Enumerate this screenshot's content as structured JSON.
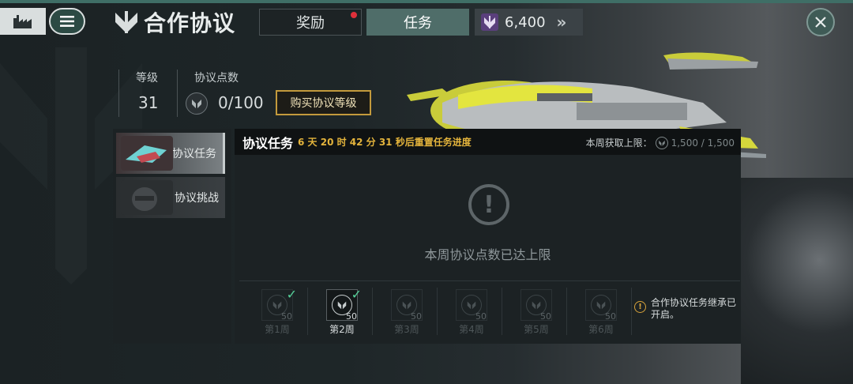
{
  "header": {
    "title": "合作协议",
    "tabs": [
      {
        "label": "奖励",
        "has_notification": true
      },
      {
        "label": "任务",
        "active": true
      }
    ],
    "currency": {
      "value": "6,400",
      "icon": "protocol-emblem-icon",
      "arrows": "»"
    }
  },
  "level": {
    "level_label": "等级",
    "level_value": "31",
    "points_label": "协议点数",
    "points_value": "0/100",
    "buy_button": "购买协议等级"
  },
  "sidebar": {
    "items": [
      {
        "label": "协议任务",
        "active": true
      },
      {
        "label": "协议挑战",
        "active": false
      }
    ]
  },
  "panel": {
    "title": "协议任务",
    "countdown": "6 天 20 时 42 分 31 秒后重置任务进度",
    "weekly_label": "本周获取上限：",
    "weekly_value": "1,500 / 1,500",
    "empty_icon": "exclamation-icon",
    "empty_message": "本周协议点数已达上限",
    "weeks": [
      {
        "label": "第1周",
        "points": "50",
        "completed": true,
        "current": false
      },
      {
        "label": "第2周",
        "points": "50",
        "completed": true,
        "current": true
      },
      {
        "label": "第3周",
        "points": "50",
        "completed": false,
        "current": false
      },
      {
        "label": "第4周",
        "points": "50",
        "completed": false,
        "current": false
      },
      {
        "label": "第5周",
        "points": "50",
        "completed": false,
        "current": false
      },
      {
        "label": "第6周",
        "points": "50",
        "completed": false,
        "current": false
      }
    ],
    "note": "合作协议任务继承已开启。"
  },
  "colors": {
    "accent_teal": "#4f6d69",
    "gold": "#c39a3c",
    "countdown": "#e4b43c",
    "check": "#56d29a",
    "notification": "#e0303a"
  }
}
